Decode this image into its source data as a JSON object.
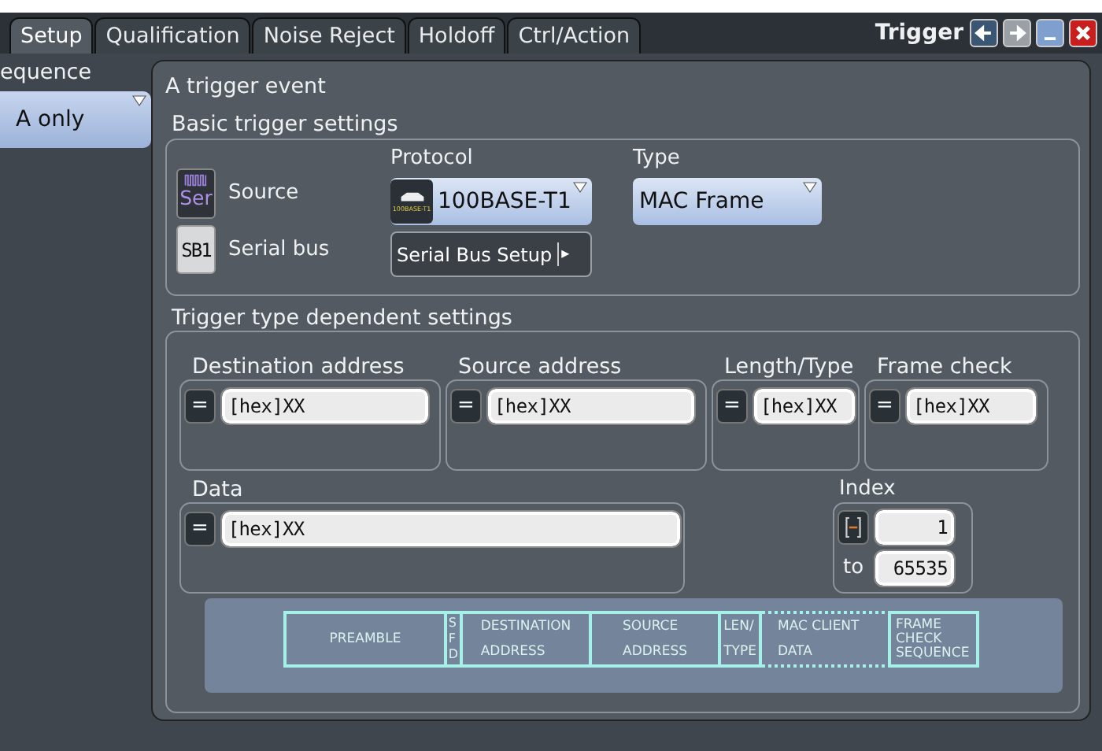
{
  "window": {
    "title": "Trigger"
  },
  "tabs": [
    {
      "label": "Setup",
      "selected": true
    },
    {
      "label": "Qualification",
      "selected": false
    },
    {
      "label": "Noise Reject",
      "selected": false
    },
    {
      "label": "Holdoff",
      "selected": false
    },
    {
      "label": "Ctrl/Action",
      "selected": false
    }
  ],
  "sidebar": {
    "label": "equence",
    "value": "A only"
  },
  "panel": {
    "title": "A trigger event"
  },
  "basic": {
    "title": "Basic trigger settings",
    "source": {
      "label": "Source",
      "icon_text": "Ser"
    },
    "serial_bus": {
      "label": "Serial bus",
      "icon_text": "SB1"
    },
    "protocol": {
      "label": "Protocol",
      "value": "100BASE-T1",
      "icon_text": "100BASE-T1"
    },
    "type": {
      "label": "Type",
      "value": "MAC Frame"
    },
    "setup_button": {
      "label": "Serial Bus Setup",
      "arrow": "▸"
    }
  },
  "dependent": {
    "title": "Trigger type dependent settings",
    "fields": [
      {
        "label": "Destination address",
        "operator": "=",
        "value": "[hex]XX"
      },
      {
        "label": "Source address",
        "operator": "=",
        "value": "[hex]XX"
      },
      {
        "label": "Length/Type",
        "operator": "=",
        "value": "[hex]XX"
      },
      {
        "label": "Frame check",
        "operator": "=",
        "value": "[hex]XX"
      }
    ],
    "data": {
      "label": "Data",
      "operator": "=",
      "value": "[hex]XX"
    },
    "index": {
      "label": "Index",
      "from": "1",
      "to_label": "to",
      "to": "65535"
    }
  },
  "frame": {
    "cells": [
      {
        "kind": "normal",
        "text": "PREAMBLE"
      },
      {
        "kind": "vertical",
        "text": "SFD"
      },
      {
        "kind": "normal",
        "text": "DESTINATION ADDRESS"
      },
      {
        "kind": "normal",
        "text": "SOURCE ADDRESS"
      },
      {
        "kind": "narrow",
        "text": "LEN/ TYPE"
      },
      {
        "kind": "dotted",
        "text": "MAC CLIENT DATA"
      },
      {
        "kind": "stacked",
        "text": "FRAME CHECK SEQUENCE"
      }
    ]
  }
}
